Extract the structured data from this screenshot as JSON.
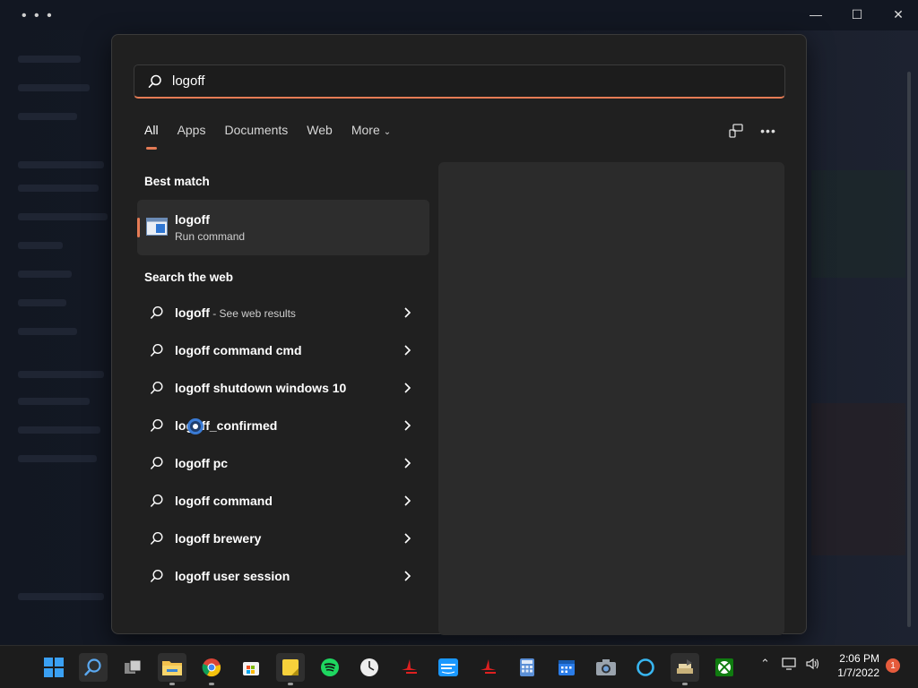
{
  "search": {
    "query": "logoff",
    "placeholder": ""
  },
  "tabs": [
    {
      "label": "All",
      "active": true
    },
    {
      "label": "Apps"
    },
    {
      "label": "Documents"
    },
    {
      "label": "Web"
    },
    {
      "label": "More"
    }
  ],
  "sections": {
    "best_match": "Best match",
    "search_web": "Search the web"
  },
  "best_match": {
    "name": "logoff",
    "subtitle": "Run command"
  },
  "web_results": [
    {
      "bold": "logoff",
      "suffix": " - See web results"
    },
    {
      "bold": "logoff command cmd",
      "suffix": ""
    },
    {
      "bold": "logoff shutdown windows 10",
      "suffix": ""
    },
    {
      "bold": "logoff_confirmed",
      "suffix": ""
    },
    {
      "bold": "logoff pc",
      "suffix": ""
    },
    {
      "bold": "logoff command",
      "suffix": ""
    },
    {
      "bold": "logoff brewery",
      "suffix": ""
    },
    {
      "bold": "logoff user session",
      "suffix": ""
    }
  ],
  "clock": {
    "time": "2:06 PM",
    "date": "1/7/2022"
  },
  "notification_count": "1",
  "colors": {
    "accent": "#e57b55",
    "panel": "#202020",
    "preview": "#2b2b2b",
    "taskbar": "#1c1c1c"
  },
  "taskbar_icons": [
    "windows-start-icon",
    "search-icon",
    "task-view-icon",
    "file-explorer-icon",
    "chrome-icon",
    "microsoft-store-icon",
    "sticky-notes-icon",
    "spotify-icon",
    "clock-app-icon",
    "red-app-icon",
    "prime-video-icon",
    "red-app-icon-2",
    "calculator-icon",
    "calendar-icon",
    "camera-icon",
    "cortana-icon",
    "stack-app-icon",
    "xbox-icon"
  ]
}
